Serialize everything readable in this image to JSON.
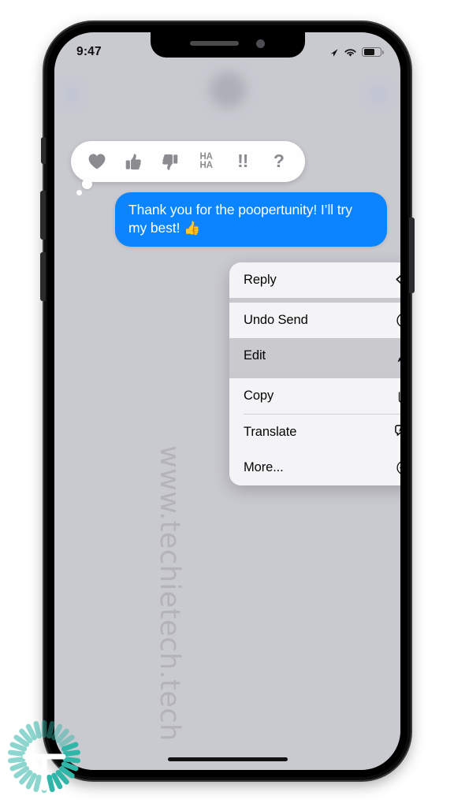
{
  "status_bar": {
    "time": "9:47",
    "location_icon": "location-arrow-icon",
    "wifi_icon": "wifi-icon",
    "battery_icon": "battery-icon",
    "battery_level_percent": 64
  },
  "tapback": {
    "title": "Tapback reactions",
    "items": [
      {
        "name": "heart",
        "glyph": "heart-icon",
        "label": "Love"
      },
      {
        "name": "thumbs-up",
        "glyph": "thumbs-up-icon",
        "label": "Like"
      },
      {
        "name": "thumbs-down",
        "glyph": "thumbs-down-icon",
        "label": "Dislike"
      },
      {
        "name": "haha",
        "glyph": "haha-text",
        "label": "HA\nHA",
        "line1": "HA",
        "line2": "HA"
      },
      {
        "name": "exclamation",
        "glyph": "exclamation-text",
        "label": "!!"
      },
      {
        "name": "question",
        "glyph": "question-text",
        "label": "?"
      }
    ]
  },
  "message": {
    "text": "Thank you for the poopertunity! I’ll try my best! ",
    "emoji": "👍",
    "sender": "outgoing",
    "bubble_color": "#0a84ff",
    "text_color": "#ffffff"
  },
  "context_menu": {
    "items": [
      {
        "label": "Reply",
        "icon": "reply-arrow-icon",
        "highlighted": false
      },
      {
        "label": "Undo Send",
        "icon": "undo-circle-icon",
        "highlighted": false
      },
      {
        "label": "Edit",
        "icon": "pencil-icon",
        "highlighted": true
      },
      {
        "label": "Copy",
        "icon": "copy-documents-icon",
        "highlighted": false
      },
      {
        "label": "Translate",
        "icon": "translate-bubbles-icon",
        "highlighted": false
      },
      {
        "label": "More...",
        "icon": "ellipsis-circle-icon",
        "highlighted": false
      }
    ]
  },
  "watermark": {
    "text": "www.techietech.tech",
    "color": "#7d7d7d"
  },
  "logo": {
    "letter": "T",
    "accent_color": "#2fb6a8"
  },
  "colors": {
    "screen_dim": "#c9c9cf",
    "menu_background": "#f4f4f6",
    "menu_highlight": "#c9c9ce",
    "imessage_blue": "#0a84ff",
    "tapback_gray": "#8b8b90"
  }
}
